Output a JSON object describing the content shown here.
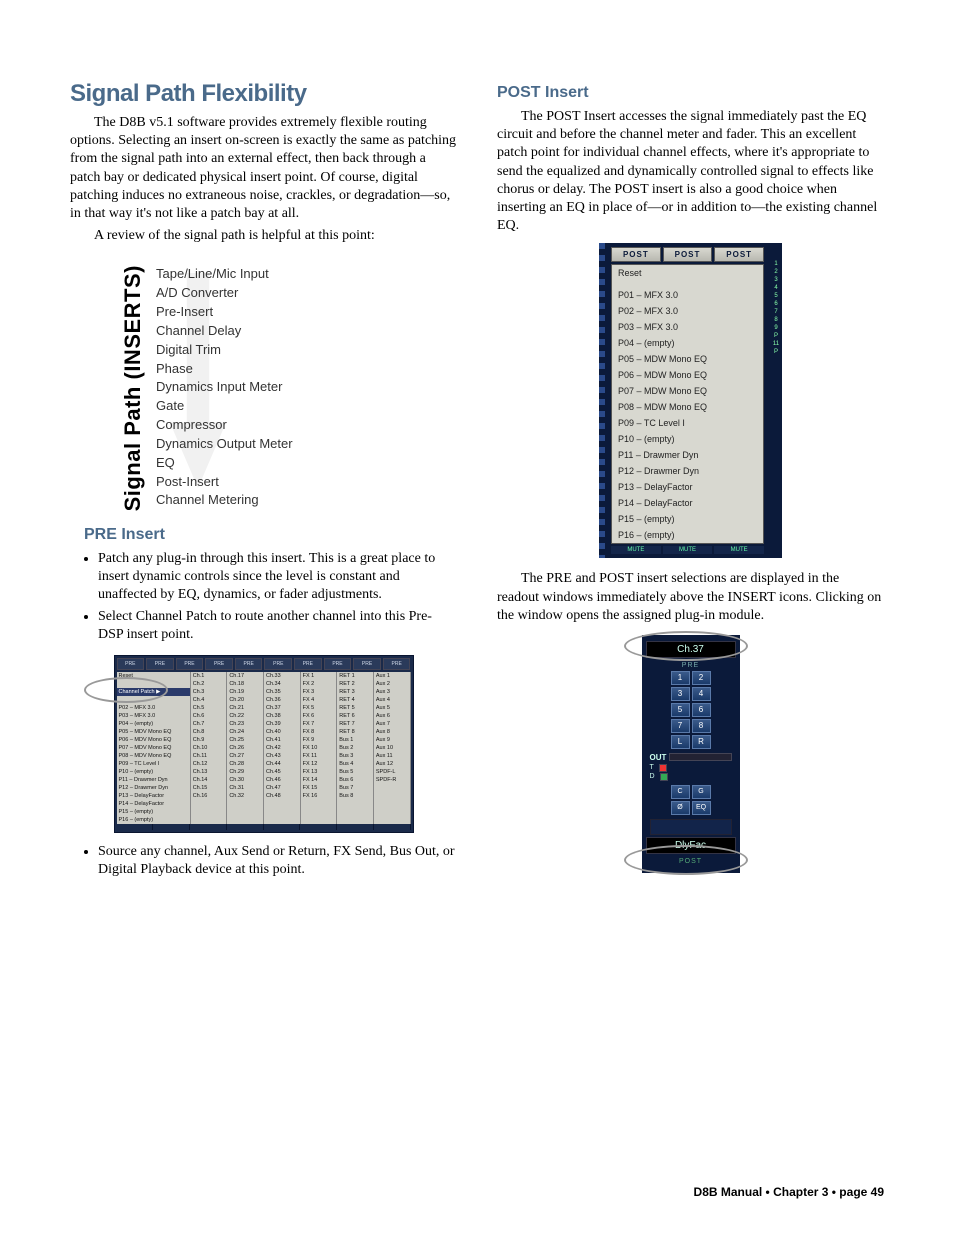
{
  "title": "Signal Path Flexibility",
  "intro_p1": "The D8B v5.1 software provides extremely flexible routing options. Selecting an insert on-screen is exactly the same as patching from the signal path into an external effect, then back through a patch bay or dedicated physical insert point. Of course, digital patching induces no extraneous noise, crackles, or degradation—so, in that way it's not like a patch bay at all.",
  "intro_p2": "A review of the signal path is helpful at this point:",
  "signal_path_label": "Signal Path (INSERTS)",
  "signal_path_items": [
    "Tape/Line/Mic Input",
    "A/D Converter",
    "Pre-Insert",
    "Channel Delay",
    "Digital Trim",
    "Phase",
    "Dynamics Input Meter",
    "Gate",
    "Compressor",
    "Dynamics Output Meter",
    "EQ",
    "Post-Insert",
    "Channel Metering"
  ],
  "pre_heading": "PRE Insert",
  "pre_bullets": [
    "Patch any plug-in through this insert. This is a great place to insert dynamic controls since the level is constant and unaffected by EQ, dynamics, or fader adjustments.",
    "Select Channel Patch to route another channel into this Pre-DSP insert point."
  ],
  "pre_bullet_after_image": "Source any channel, Aux Send or Return, FX Send, Bus Out, or Digital Playback device at this point.",
  "pre_panel": {
    "top_tabs": [
      "PRE",
      "PRE",
      "PRE",
      "PRE",
      "PRE",
      "PRE",
      "PRE",
      "PRE",
      "PRE",
      "PRE"
    ],
    "reset": "Reset",
    "channel_patch": "Channel Patch",
    "first_col": [
      "P02 – MFX 3.0",
      "P03 – MFX 3.0",
      "P04 – (empty)",
      "P05 – MDV Mono EQ",
      "P06 – MDV Mono EQ",
      "P07 – MDV Mono EQ",
      "P08 – MDV Mono EQ",
      "P09 – TC Level I",
      "P10 – (empty)",
      "P11 – Drawmer Dyn",
      "P12 – Drawmer Dyn",
      "P13 – DelayFactor",
      "P14 – DelayFactor",
      "P15 – (empty)",
      "P16 – (empty)"
    ],
    "ch_a": [
      "Ch.1",
      "Ch.2",
      "Ch.3",
      "Ch.4",
      "Ch.5",
      "Ch.6",
      "Ch.7",
      "Ch.8",
      "Ch.9",
      "Ch.10",
      "Ch.11",
      "Ch.12",
      "Ch.13",
      "Ch.14",
      "Ch.15",
      "Ch.16"
    ],
    "ch_b": [
      "Ch.17",
      "Ch.18",
      "Ch.19",
      "Ch.20",
      "Ch.21",
      "Ch.22",
      "Ch.23",
      "Ch.24",
      "Ch.25",
      "Ch.26",
      "Ch.27",
      "Ch.28",
      "Ch.29",
      "Ch.30",
      "Ch.31",
      "Ch.32"
    ],
    "ch_c": [
      "Ch.33",
      "Ch.34",
      "Ch.35",
      "Ch.36",
      "Ch.37",
      "Ch.38",
      "Ch.39",
      "Ch.40",
      "Ch.41",
      "Ch.42",
      "Ch.43",
      "Ch.44",
      "Ch.45",
      "Ch.46",
      "Ch.47",
      "Ch.48"
    ],
    "fx": [
      "FX 1",
      "FX 2",
      "FX 3",
      "FX 4",
      "FX 5",
      "FX 6",
      "FX 7",
      "FX 8",
      "FX 9",
      "FX 10",
      "FX 11",
      "FX 12",
      "FX 13",
      "FX 14",
      "FX 15",
      "FX 16"
    ],
    "ret": [
      "RET 1",
      "RET 2",
      "RET 3",
      "RET 4",
      "RET 5",
      "RET 6",
      "RET 7",
      "RET 8",
      "Bus 1",
      "Bus 2",
      "Bus 3",
      "Bus 4",
      "Bus 5",
      "Bus 6",
      "Bus 7",
      "Bus 8"
    ],
    "aux": [
      "Aux 1",
      "Aux 2",
      "Aux 3",
      "Aux 4",
      "Aux 5",
      "Aux 6",
      "Aux 7",
      "Aux 8",
      "Aux 9",
      "Aux 10",
      "Aux 11",
      "Aux 12",
      "SPDF-L",
      "SPDF-R",
      "",
      ""
    ]
  },
  "post_heading": "POST Insert",
  "post_p": "The POST Insert accesses the signal immediately past the EQ circuit and before the channel meter and fader. This an excellent patch point for individual channel effects, where it's appropriate to send the equalized and dynamically controlled signal to effects like chorus or delay. The POST insert is also a good choice when inserting an EQ in place of—or in addition to—the existing channel EQ.",
  "post_panel": {
    "tabs": [
      "POST",
      "POST",
      "POST"
    ],
    "menu": [
      "Reset",
      "",
      "P01 – MFX 3.0",
      "P02 – MFX 3.0",
      "P03 – MFX 3.0",
      "P04 – (empty)",
      "P05 – MDW Mono EQ",
      "P06 – MDW Mono EQ",
      "P07 – MDW Mono EQ",
      "P08 – MDW Mono EQ",
      "P09 – TC Level I",
      "P10 – (empty)",
      "P11 – Drawmer Dyn",
      "P12 – Drawmer Dyn",
      "P13 – DelayFactor",
      "P14 – DelayFactor",
      "P15 – (empty)",
      "P16 – (empty)"
    ],
    "side_nums": [
      "1",
      "2",
      "3",
      "4",
      "5",
      "6",
      "7",
      "8",
      "9",
      "P",
      "11",
      "P"
    ],
    "mute": "MUTE"
  },
  "post_after_p": "The PRE and POST insert selections are displayed in the readout windows immediately above the INSERT icons. Clicking on the window opens the assigned plug-in module.",
  "strip": {
    "ch_label": "Ch.37",
    "pre": "PRE",
    "nums": [
      "1",
      "2",
      "3",
      "4",
      "5",
      "6",
      "7",
      "8"
    ],
    "L": "L",
    "R": "R",
    "out": "OUT",
    "t": "T",
    "d": "D",
    "c": "C",
    "g": "G",
    "o": "Ø",
    "eq": "EQ",
    "readout": "DlyFac",
    "post": "POST"
  },
  "footer": "D8B Manual • Chapter 3 • page  49"
}
